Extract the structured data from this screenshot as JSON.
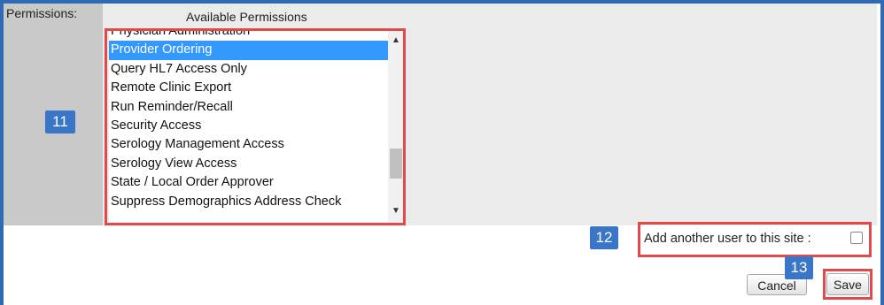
{
  "permissions_section": {
    "label": "Permissions:",
    "available_title": "Available Permissions",
    "items": [
      {
        "label": "Physician Administration",
        "selected": false
      },
      {
        "label": "Provider Ordering",
        "selected": true
      },
      {
        "label": "Query HL7 Access Only",
        "selected": false
      },
      {
        "label": "Remote Clinic Export",
        "selected": false
      },
      {
        "label": "Run Reminder/Recall",
        "selected": false
      },
      {
        "label": "Security Access",
        "selected": false
      },
      {
        "label": "Serology Management Access",
        "selected": false
      },
      {
        "label": "Serology View Access",
        "selected": false
      },
      {
        "label": "State / Local Order Approver",
        "selected": false
      },
      {
        "label": "Suppress Demographics Address Check",
        "selected": false
      }
    ]
  },
  "add_user": {
    "label": "Add another user to this site :",
    "checked": false
  },
  "buttons": {
    "cancel": "Cancel",
    "save": "Save"
  },
  "callouts": {
    "list": "11",
    "add_user": "12",
    "save": "13"
  },
  "icons": {
    "scroll_up": "triangle-up-icon",
    "scroll_down": "triangle-down-icon"
  },
  "colors": {
    "frame": "#2e6bb3",
    "selection": "#3399ff",
    "callout": "#3a76c8",
    "highlight": "#e04a4a"
  }
}
